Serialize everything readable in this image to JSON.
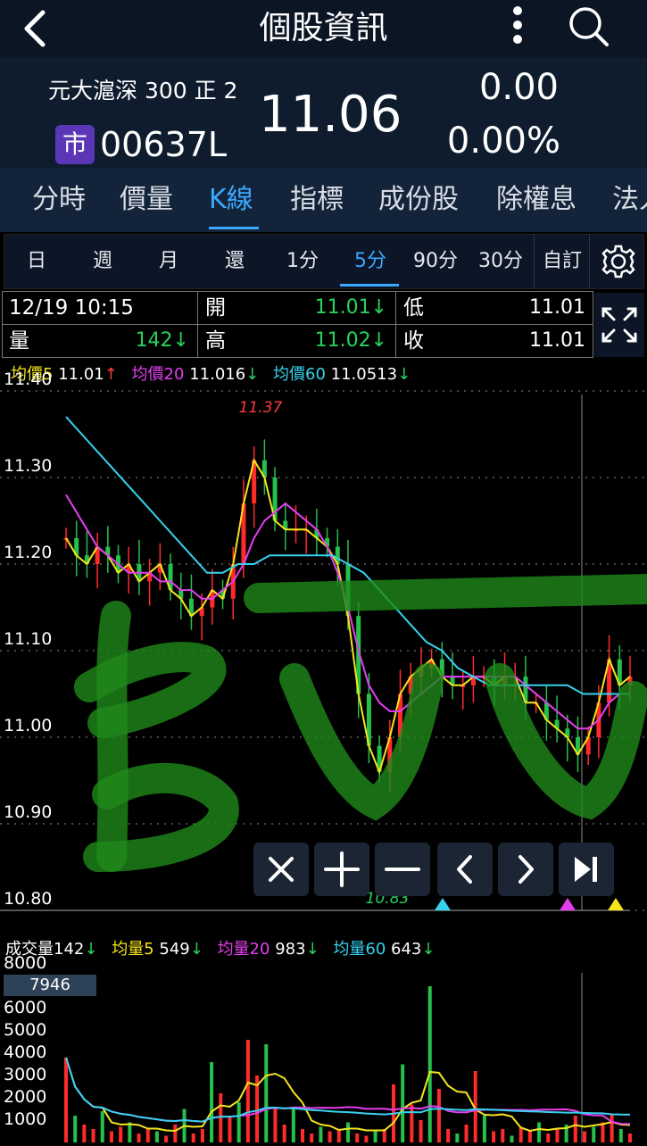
{
  "app_bar": {
    "title": "個股資訊"
  },
  "quote": {
    "name": "元大滬深 300 正 2",
    "market_badge": "市",
    "code": "00637L",
    "price": "11.06",
    "change": "0.00",
    "change_pct": "0.00%"
  },
  "main_tabs": [
    "分時",
    "價量",
    "K線",
    "指標",
    "成份股",
    "除權息",
    "法人"
  ],
  "main_tab_active": "K線",
  "period_tabs": [
    "日",
    "週",
    "月",
    "還",
    "1分",
    "5分",
    "90分",
    "30分"
  ],
  "period_active": "5分",
  "custom_label": "自訂",
  "ohlc": {
    "datetime": "12/19 10:15",
    "open_label": "開",
    "open": "11.01↓",
    "low_label": "低",
    "low": "11.01",
    "volume_label": "量",
    "volume": "142↓",
    "high_label": "高",
    "high": "11.02↓",
    "close_label": "收",
    "close": "11.01"
  },
  "ma_legend": {
    "ma5_label": "均價5",
    "ma5": "11.01",
    "ma5_arrow": "↑",
    "ma20_label": "均價20",
    "ma20": "11.016",
    "ma20_arrow": "↓",
    "ma60_label": "均價60",
    "ma60": "11.0513",
    "ma60_arrow": "↓"
  },
  "vol_legend": {
    "vol_label": "成交量",
    "vol": "142",
    "vol_arrow": "↓",
    "v5_label": "均量5",
    "v5": "549",
    "v5_arrow": "↓",
    "v20_label": "均量20",
    "v20": "983",
    "v20_arrow": "↓",
    "v60_label": "均量60",
    "v60": "643",
    "v60_arrow": "↓"
  },
  "chart_data": [
    {
      "type": "line",
      "y_ticks": [
        "11.40",
        "11.30",
        "11.20",
        "11.10",
        "11.00",
        "10.90",
        "10.80"
      ],
      "ylim": [
        10.8,
        11.4
      ],
      "annotations": {
        "high": "11.37",
        "low": "10.83"
      },
      "series": [
        {
          "name": "均價5",
          "color": "#f4e51c",
          "values": [
            11.23,
            11.21,
            11.2,
            11.22,
            11.21,
            11.19,
            11.2,
            11.18,
            11.19,
            11.2,
            11.17,
            11.16,
            11.14,
            11.15,
            11.17,
            11.16,
            11.2,
            11.27,
            11.32,
            11.3,
            11.25,
            11.24,
            11.24,
            11.24,
            11.23,
            11.22,
            11.2,
            11.14,
            11.05,
            10.99,
            10.96,
            11.0,
            11.05,
            11.07,
            11.08,
            11.09,
            11.07,
            11.06,
            11.06,
            11.07,
            11.07,
            11.06,
            11.07,
            11.07,
            11.04,
            11.04,
            11.02,
            11.01,
            11.0,
            10.98,
            11.0,
            11.04,
            11.09,
            11.06,
            11.07
          ]
        },
        {
          "name": "均價20",
          "color": "#e43ef0",
          "values": [
            11.28,
            11.26,
            11.24,
            11.22,
            11.21,
            11.2,
            11.19,
            11.19,
            11.19,
            11.18,
            11.18,
            11.17,
            11.17,
            11.16,
            11.16,
            11.17,
            11.18,
            11.2,
            11.23,
            11.25,
            11.26,
            11.27,
            11.26,
            11.25,
            11.24,
            11.22,
            11.19,
            11.15,
            11.1,
            11.06,
            11.04,
            11.03,
            11.03,
            11.04,
            11.05,
            11.06,
            11.07,
            11.07,
            11.07,
            11.07,
            11.07,
            11.07,
            11.07,
            11.07,
            11.06,
            11.05,
            11.04,
            11.03,
            11.02,
            11.01,
            11.01,
            11.02,
            11.04,
            11.05,
            11.05
          ]
        },
        {
          "name": "均價60",
          "color": "#37d2ee",
          "values": [
            11.37,
            11.35,
            11.33,
            11.31,
            11.29,
            11.27,
            11.25,
            11.23,
            11.21,
            11.19,
            11.19,
            11.2,
            11.2,
            11.21,
            11.21,
            11.21,
            11.21,
            11.21,
            11.2,
            11.19,
            11.17,
            11.15,
            11.13,
            11.11,
            11.1,
            11.08,
            11.07,
            11.06,
            11.06,
            11.06,
            11.06,
            11.06,
            11.06,
            11.05,
            11.05,
            11.05,
            11.05
          ]
        }
      ]
    },
    {
      "type": "bar",
      "y_ticks": [
        "8000",
        "7946",
        "6000",
        "5000",
        "4000",
        "3000",
        "2000",
        "1000"
      ],
      "ylim": [
        0,
        8000
      ],
      "values": [
        3800,
        1200,
        800,
        600,
        1400,
        500,
        700,
        900,
        400,
        600,
        500,
        300,
        800,
        1500,
        400,
        600,
        3600,
        2200,
        1200,
        1800,
        4600,
        3000,
        4400,
        1600,
        800,
        1500,
        600,
        400,
        700,
        500,
        600,
        900,
        400,
        300,
        500,
        600,
        2600,
        3500,
        1700,
        1000,
        7000,
        2400,
        600,
        400,
        800,
        3200,
        1200,
        500,
        600,
        300,
        700,
        500,
        900,
        400,
        600,
        800,
        1200,
        500,
        700,
        900,
        1300,
        600,
        400
      ]
    }
  ]
}
